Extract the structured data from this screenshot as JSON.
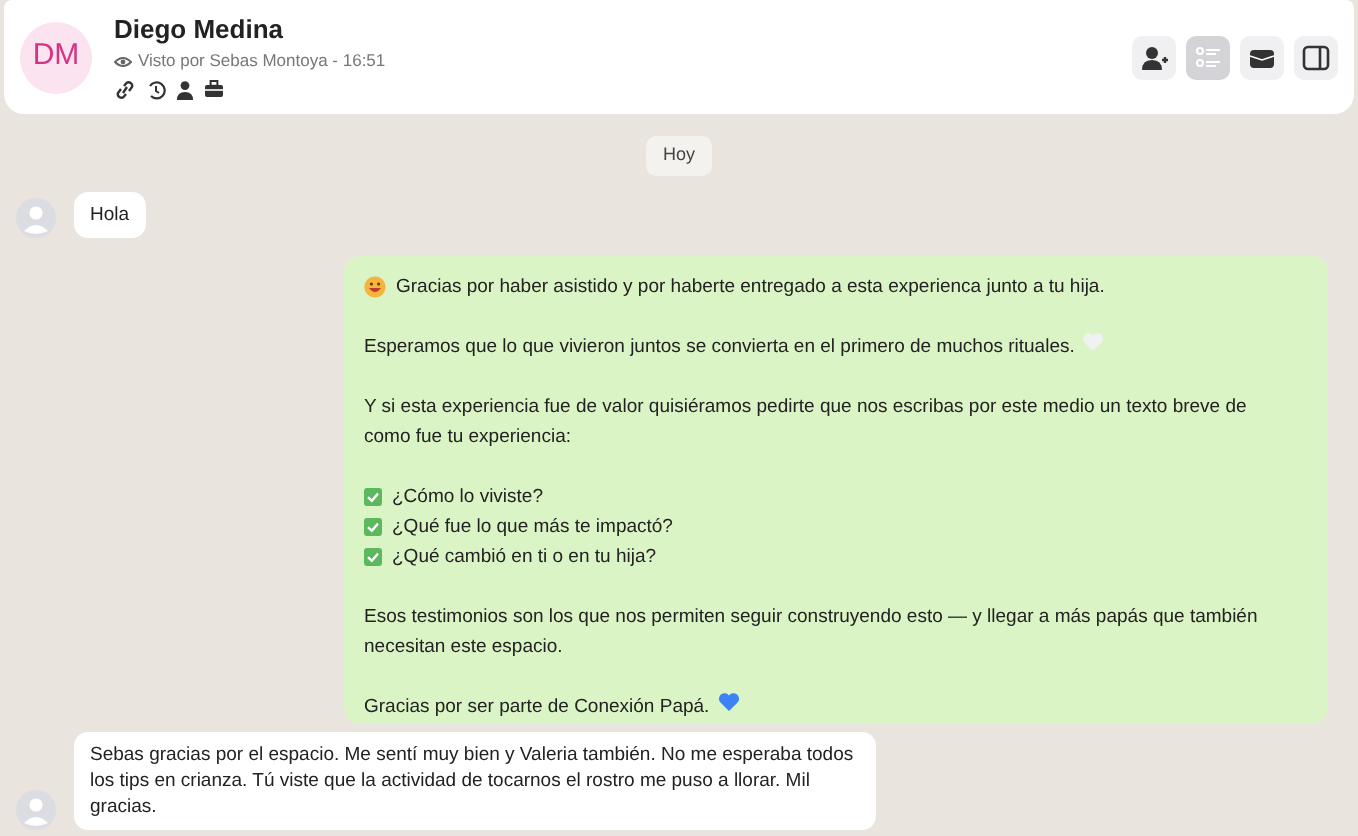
{
  "contact": {
    "initials": "DM",
    "name": "Diego Medina",
    "seen": "Visto por Sebas Montoya - 16:51"
  },
  "header_buttons": [
    {
      "selected": false
    },
    {
      "selected": true
    },
    {
      "selected": false
    },
    {
      "selected": false
    }
  ],
  "date_pill": "Hoy",
  "messages": [
    {
      "kind": "incoming",
      "text": "Hola"
    },
    {
      "kind": "outgoing",
      "blocks": [
        {
          "kind": "face_paragraph",
          "text": "Gracias por haber asistido y por haberte entregado a esta experienca junto a tu hija."
        },
        {
          "kind": "white_heart_paragraph",
          "text": "Esperamos que lo que vivieron juntos se convierta en el primero de muchos rituales."
        },
        {
          "kind": "paragraph",
          "text": "Y si esta experiencia fue de valor quisiéramos pedirte que nos escribas por este medio un texto breve de como fue tu experiencia:"
        },
        {
          "kind": "checklist",
          "items": [
            {
              "text": "¿Cómo lo viviste?",
              "checked": true
            },
            {
              "text": "¿Qué fue lo que más te impactó?",
              "checked": true
            },
            {
              "text": "¿Qué cambió en ti o en tu hija?",
              "checked": true
            }
          ]
        },
        {
          "kind": "paragraph",
          "text": "Esos testimonios son los que nos permiten seguir construyendo esto — y llegar a más papás que también necesitan este espacio."
        },
        {
          "kind": "blue_heart_paragraph",
          "text": "Gracias por ser parte de Conexión Papá."
        }
      ]
    },
    {
      "kind": "incoming",
      "text": "Sebas gracias por el espacio. Me sentí muy bien y Valeria también. No me esperaba todos los tips en crianza. Tú viste que la actividad de tocarnos el rostro me puso a llorar. Mil gracias."
    }
  ]
}
